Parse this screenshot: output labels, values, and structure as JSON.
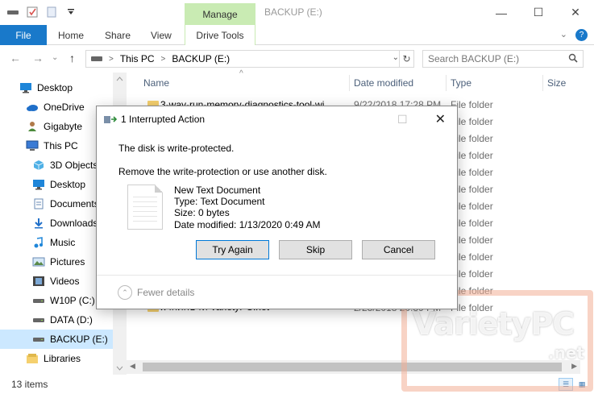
{
  "window": {
    "title": "BACKUP (E:)",
    "manage_tab": "Manage",
    "minimize": "—",
    "maximize": "☐",
    "close": "✕"
  },
  "ribbon": {
    "tabs": [
      "File",
      "Home",
      "Share",
      "View",
      "Drive Tools"
    ],
    "collapse": "⌄",
    "help": "?"
  },
  "nav": {
    "back": "←",
    "forward": "→",
    "recent": "⌄",
    "up": "↑",
    "path": [
      "This PC",
      "BACKUP (E:)"
    ],
    "separator": ">",
    "dropdown": "⌄",
    "refresh": "↻",
    "search_placeholder": "Search BACKUP (E:)"
  },
  "sidebar": {
    "items": [
      {
        "label": "Desktop",
        "icon": "desktop-icon"
      },
      {
        "label": "OneDrive",
        "icon": "cloud-icon"
      },
      {
        "label": "Gigabyte",
        "icon": "user-icon"
      },
      {
        "label": "This PC",
        "icon": "computer-icon"
      },
      {
        "label": "3D Objects",
        "icon": "cube-icon"
      },
      {
        "label": "Desktop",
        "icon": "desktop-icon"
      },
      {
        "label": "Documents",
        "icon": "document-icon"
      },
      {
        "label": "Downloads",
        "icon": "download-icon"
      },
      {
        "label": "Music",
        "icon": "music-icon"
      },
      {
        "label": "Pictures",
        "icon": "picture-icon"
      },
      {
        "label": "Videos",
        "icon": "video-icon"
      },
      {
        "label": "W10P (C:)",
        "icon": "drive-icon"
      },
      {
        "label": "DATA (D:)",
        "icon": "drive-icon"
      },
      {
        "label": "BACKUP (E:)",
        "icon": "drive-icon",
        "selected": true
      },
      {
        "label": "Libraries",
        "icon": "library-icon"
      }
    ]
  },
  "filelist": {
    "columns": [
      "Name",
      "Date modified",
      "Type",
      "Size"
    ],
    "sort_arrow": "^",
    "rows": [
      {
        "name": "3-way-run-memory-diagnostics-tool-wi...",
        "date": "9/22/2018 17:28 PM",
        "type": "File folder"
      },
      {
        "name": "",
        "date": "",
        "type": "File folder"
      },
      {
        "name": "",
        "date": "",
        "type": "File folder"
      },
      {
        "name": "",
        "date": "",
        "type": "File folder"
      },
      {
        "name": "",
        "date": "",
        "type": "File folder"
      },
      {
        "name": "",
        "date": "",
        "type": "File folder"
      },
      {
        "name": "",
        "date": "",
        "type": "File folder"
      },
      {
        "name": "",
        "date": "",
        "type": "File folder"
      },
      {
        "name": "",
        "date": "",
        "type": "File folder"
      },
      {
        "name": "",
        "date": "",
        "type": "File folder"
      },
      {
        "name": "",
        "date": "",
        "type": "File folder"
      },
      {
        "name": "",
        "date": "",
        "type": "File folder"
      },
      {
        "name": "ฝากศึกษาที่ VarietyPC.net",
        "date": "2/23/2018 20:39 PM",
        "type": "File folder"
      }
    ]
  },
  "status": {
    "items_count": "13 items"
  },
  "dialog": {
    "title": "1 Interrupted Action",
    "maximize": "☐",
    "close": "✕",
    "message": "The disk is write-protected.",
    "instruction": "Remove the write-protection or use another disk.",
    "file": {
      "name": "New Text Document",
      "type": "Type: Text Document",
      "size": "Size: 0 bytes",
      "date": "Date modified: 1/13/2020 0:49 AM"
    },
    "buttons": {
      "try_again": "Try Again",
      "skip": "Skip",
      "cancel": "Cancel"
    },
    "fewer_details": "Fewer details",
    "fewer_icon": "⌃"
  },
  "watermark": {
    "text": "VarietyPC",
    "suffix": ".net"
  },
  "colors": {
    "accent": "#1979ca",
    "manage_tab": "#c9ebb3",
    "selected": "#cce8ff"
  }
}
